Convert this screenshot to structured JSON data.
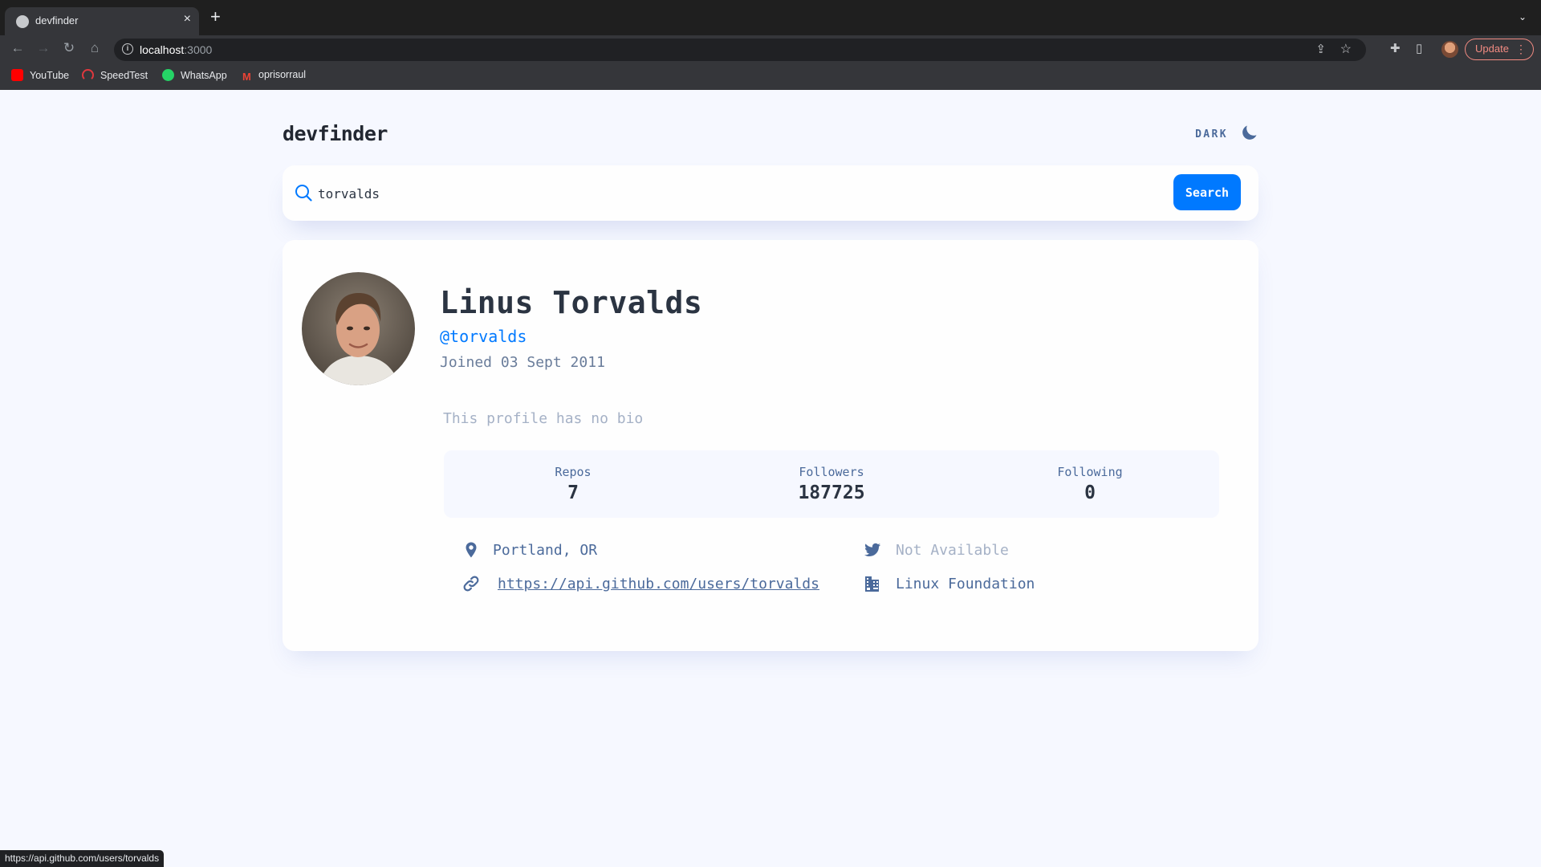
{
  "browser": {
    "tab_title": "devfinder",
    "tab_close": "×",
    "new_tab": "+",
    "tab_menu": "⌄",
    "url_host": "localhost",
    "url_port": ":3000",
    "update_label": "Update",
    "bookmarks": [
      "YouTube",
      "SpeedTest",
      "WhatsApp",
      "oprisorraul"
    ],
    "status_url": "https://api.github.com/users/torvalds"
  },
  "app": {
    "logo": "devfinder",
    "theme_label": "DARK",
    "search": {
      "value": "torvalds",
      "button_label": "Search"
    },
    "profile": {
      "name": "Linus Torvalds",
      "handle": "@torvalds",
      "joined": "Joined 03 Sept 2011",
      "bio": "This profile has no bio",
      "stats": {
        "repos_label": "Repos",
        "repos_value": "7",
        "followers_label": "Followers",
        "followers_value": "187725",
        "following_label": "Following",
        "following_value": "0"
      },
      "location": "Portland, OR",
      "twitter": "Not Available",
      "blog": "https://api.github.com/users/torvalds",
      "company": "Linux Foundation"
    }
  },
  "colors": {
    "accent": "#0079ff",
    "text_primary": "#2b3442",
    "text_secondary": "#4b6a9b",
    "text_muted": "#a5b1c6",
    "page_bg": "#f6f8ff",
    "card_bg": "#fefefe"
  }
}
